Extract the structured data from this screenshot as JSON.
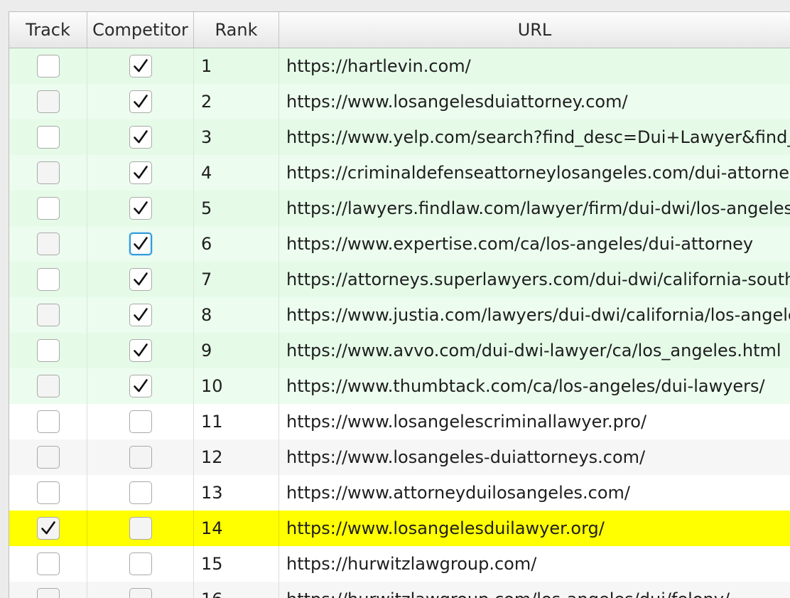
{
  "columns": {
    "track": "Track",
    "competitor": "Competitor",
    "rank": "Rank",
    "url": "URL"
  },
  "rows": [
    {
      "rank": "1",
      "url": "https://hartlevin.com/",
      "track": false,
      "competitor": true,
      "style": "green"
    },
    {
      "rank": "2",
      "url": "https://www.losangelesduiattorney.com/",
      "track": false,
      "competitor": true,
      "style": "green"
    },
    {
      "rank": "3",
      "url": "https://www.yelp.com/search?find_desc=Dui+Lawyer&find_loc=Los",
      "track": false,
      "competitor": true,
      "style": "green"
    },
    {
      "rank": "4",
      "url": "https://criminaldefenseattorneylosangeles.com/dui-attorney/",
      "track": false,
      "competitor": true,
      "style": "green"
    },
    {
      "rank": "5",
      "url": "https://lawyers.findlaw.com/lawyer/firm/dui-dwi/los-angeles/california",
      "track": false,
      "competitor": true,
      "style": "green"
    },
    {
      "rank": "6",
      "url": "https://www.expertise.com/ca/los-angeles/dui-attorney",
      "track": false,
      "competitor": true,
      "style": "green",
      "focused": true
    },
    {
      "rank": "7",
      "url": "https://attorneys.superlawyers.com/dui-dwi/california-southern/los",
      "track": false,
      "competitor": true,
      "style": "green"
    },
    {
      "rank": "8",
      "url": "https://www.justia.com/lawyers/dui-dwi/california/los-angeles",
      "track": false,
      "competitor": true,
      "style": "green"
    },
    {
      "rank": "9",
      "url": "https://www.avvo.com/dui-dwi-lawyer/ca/los_angeles.html",
      "track": false,
      "competitor": true,
      "style": "green"
    },
    {
      "rank": "10",
      "url": "https://www.thumbtack.com/ca/los-angeles/dui-lawyers/",
      "track": false,
      "competitor": true,
      "style": "green"
    },
    {
      "rank": "11",
      "url": "https://www.losangelescriminallawyer.pro/",
      "track": false,
      "competitor": false,
      "style": "white"
    },
    {
      "rank": "12",
      "url": "https://www.losangeles-duiattorneys.com/",
      "track": false,
      "competitor": false,
      "style": "gray"
    },
    {
      "rank": "13",
      "url": "https://www.attorneyduilosangeles.com/",
      "track": false,
      "competitor": false,
      "style": "white"
    },
    {
      "rank": "14",
      "url": "https://www.losangelesduilawyer.org/",
      "track": true,
      "competitor": false,
      "style": "yellow"
    },
    {
      "rank": "15",
      "url": "https://hurwitzlawgroup.com/",
      "track": false,
      "competitor": false,
      "style": "white"
    },
    {
      "rank": "16",
      "url": "https://hurwitzlawgroup.com/los-angeles/dui/felony/",
      "track": false,
      "competitor": false,
      "style": "gray"
    }
  ],
  "colors": {
    "competitor_row": "#e5fbe8",
    "tracked_row": "#ffff00",
    "focus_ring": "#2f9bd9"
  },
  "icons": {
    "checked": "checkmark-icon"
  }
}
